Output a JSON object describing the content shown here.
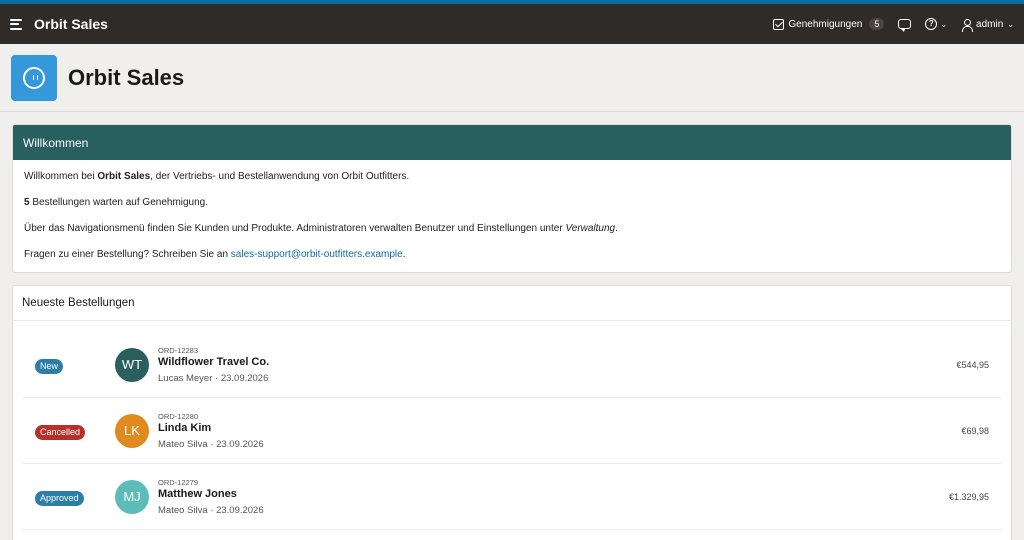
{
  "header": {
    "app_name": "Orbit Sales",
    "approvals_label": "Genehmigungen",
    "approvals_count": "5",
    "user_label": "admin"
  },
  "hero": {
    "title": "Orbit Sales"
  },
  "welcome": {
    "title": "Willkommen",
    "line1_pre": "Willkommen bei ",
    "line1_bold": "Orbit Sales",
    "line1_post": ", der Vertriebs- und Bestellanwendung von Orbit Outfitters.",
    "line2_count": "5",
    "line2_text": " Bestellungen warten auf Genehmigung.",
    "line3_pre": "Über das Navigationsmenü finden Sie Kunden und Produkte. Administratoren verwalten Benutzer und Einstellungen unter ",
    "line3_em": "Verwaltung",
    "line3_post": ".",
    "line4_pre": "Fragen zu einer Bestellung? Schreiben Sie an ",
    "line4_link": "sales-support@orbit-outfitters.example",
    "line4_post": "."
  },
  "orders": {
    "title": "Neueste Bestellungen",
    "items": [
      {
        "status": "New",
        "status_color": "#2a7ea8",
        "initials": "WT",
        "avatar_color": "#2a5f5e",
        "id": "ORD-12283",
        "name": "Wildflower Travel Co.",
        "meta": "Lucas Meyer · 23.09.2026",
        "amount": "€544,95"
      },
      {
        "status": "Cancelled",
        "status_color": "#b7312a",
        "initials": "LK",
        "avatar_color": "#e08a1f",
        "id": "ORD-12280",
        "name": "Linda Kim",
        "meta": "Mateo Silva · 23.09.2026",
        "amount": "€69,98"
      },
      {
        "status": "Approved",
        "status_color": "#2a7ea8",
        "initials": "MJ",
        "avatar_color": "#5bbcb8",
        "id": "ORD-12279",
        "name": "Matthew Jones",
        "meta": "Mateo Silva · 23.09.2026",
        "amount": "€1.329,95"
      }
    ]
  }
}
